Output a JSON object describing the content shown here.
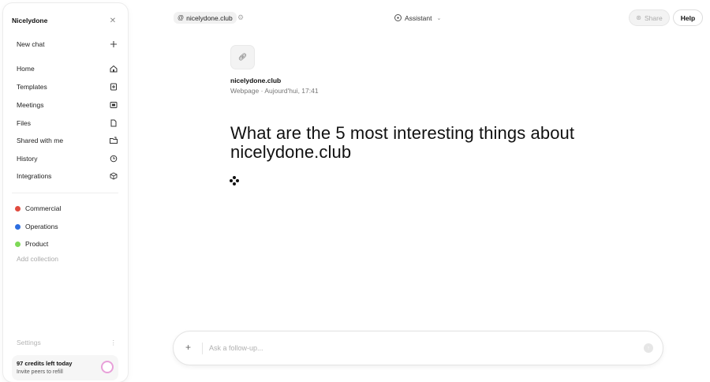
{
  "sidebar": {
    "title": "Nicelydone",
    "close_icon": "close-icon",
    "new_chat": {
      "label": "New chat",
      "icon": "plus-icon"
    },
    "nav": [
      {
        "label": "Home",
        "icon": "home-icon"
      },
      {
        "label": "Templates",
        "icon": "template-icon"
      },
      {
        "label": "Meetings",
        "icon": "meetings-icon"
      },
      {
        "label": "Files",
        "icon": "file-icon"
      },
      {
        "label": "Shared with me",
        "icon": "shared-folder-icon"
      },
      {
        "label": "History",
        "icon": "history-icon"
      },
      {
        "label": "Integrations",
        "icon": "cube-icon"
      }
    ],
    "collections": [
      {
        "label": "Commercial",
        "color": "#e04b3f"
      },
      {
        "label": "Operations",
        "color": "#2d6ee0"
      },
      {
        "label": "Product",
        "color": "#7ed957"
      }
    ],
    "add_collection": "Add collection",
    "settings": "Settings",
    "credits": {
      "title": "97 credits left today",
      "subtitle": "Invite peers to refill",
      "ring_color": "#e8a0d9"
    }
  },
  "topbar": {
    "source_chip": "nicelydone.club",
    "assistant": "Assistant",
    "share": "Share",
    "help": "Help"
  },
  "main": {
    "source_title": "nicelydone.club",
    "source_meta": "Webpage · Aujourd'hui, 17:41",
    "question": "What are the 5 most interesting things about nicelydone.club"
  },
  "composer": {
    "placeholder": "Ask a follow-up..."
  }
}
